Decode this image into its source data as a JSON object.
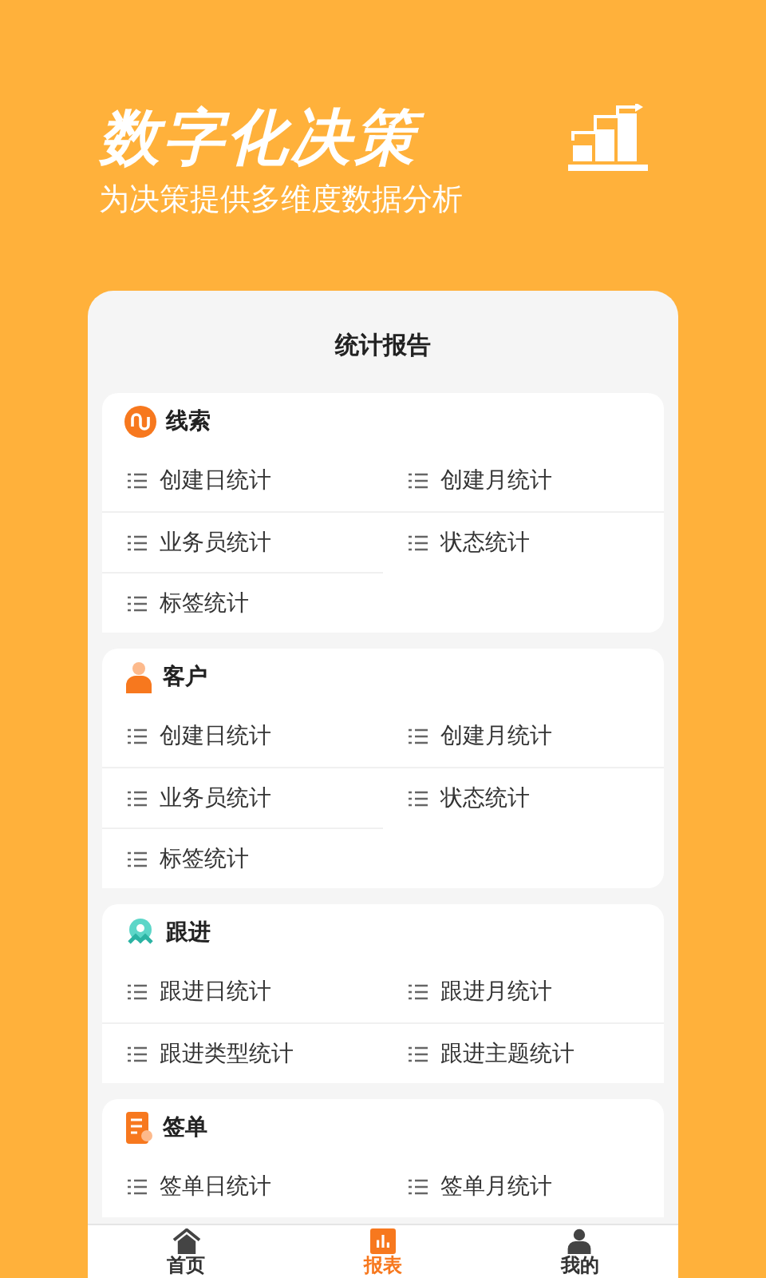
{
  "header": {
    "title": "数字化决策",
    "subtitle": "为决策提供多维度数据分析"
  },
  "card": {
    "title": "统计报告"
  },
  "sections": [
    {
      "kind": "clue",
      "title": "线索",
      "items": [
        "创建日统计",
        "创建月统计",
        "业务员统计",
        "状态统计",
        "标签统计"
      ]
    },
    {
      "kind": "customer",
      "title": "客户",
      "items": [
        "创建日统计",
        "创建月统计",
        "业务员统计",
        "状态统计",
        "标签统计"
      ]
    },
    {
      "kind": "followup",
      "title": "跟进",
      "items": [
        "跟进日统计",
        "跟进月统计",
        "跟进类型统计",
        "跟进主题统计"
      ]
    },
    {
      "kind": "order",
      "title": "签单",
      "items": [
        "签单日统计",
        "签单月统计"
      ]
    }
  ],
  "tabs": [
    {
      "kind": "home",
      "label": "首页",
      "selected": false
    },
    {
      "kind": "report",
      "label": "报表",
      "selected": true
    },
    {
      "kind": "me",
      "label": "我的",
      "selected": false
    }
  ]
}
